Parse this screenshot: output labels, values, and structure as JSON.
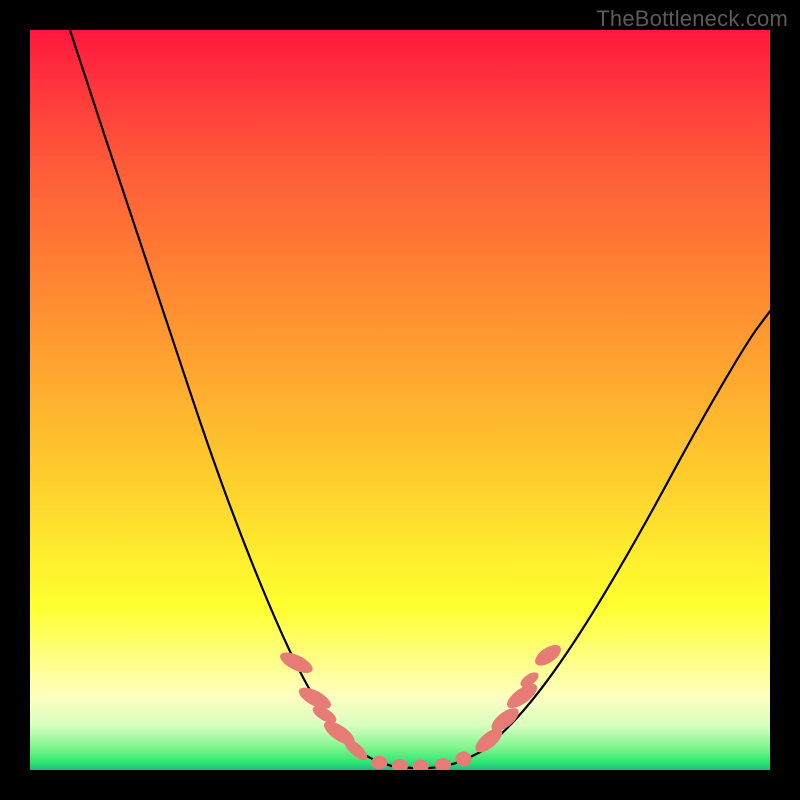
{
  "watermark": "TheBottleneck.com",
  "colors": {
    "background": "#000000",
    "curve": "#000000",
    "marker": "#e77b75",
    "gradient_top": "#ff173e",
    "gradient_bottom": "#1fb981"
  },
  "chart_data": {
    "type": "line",
    "title": "",
    "xlabel": "",
    "ylabel": "",
    "x_range": [
      0,
      1
    ],
    "y_range": [
      0,
      1
    ],
    "series": [
      {
        "name": "left-branch",
        "x": [
          0.054,
          0.08,
          0.12,
          0.16,
          0.2,
          0.24,
          0.28,
          0.32,
          0.36,
          0.4,
          0.43,
          0.46,
          0.49
        ],
        "y": [
          1.0,
          0.92,
          0.8,
          0.68,
          0.56,
          0.44,
          0.33,
          0.23,
          0.14,
          0.07,
          0.035,
          0.015,
          0.005
        ]
      },
      {
        "name": "valley",
        "x": [
          0.49,
          0.52,
          0.55,
          0.58,
          0.61
        ],
        "y": [
          0.005,
          0.002,
          0.003,
          0.01,
          0.025
        ]
      },
      {
        "name": "right-branch",
        "x": [
          0.61,
          0.65,
          0.7,
          0.76,
          0.83,
          0.9,
          0.97,
          1.0
        ],
        "y": [
          0.025,
          0.06,
          0.12,
          0.21,
          0.33,
          0.46,
          0.58,
          0.62
        ]
      }
    ],
    "markers": [
      {
        "group": "left-lobes",
        "x": 0.36,
        "y": 0.145,
        "rx": 0.01,
        "ry": 0.024,
        "rot": -64
      },
      {
        "group": "left-lobes",
        "x": 0.385,
        "y": 0.097,
        "rx": 0.01,
        "ry": 0.024,
        "rot": -62
      },
      {
        "group": "left-lobes",
        "x": 0.398,
        "y": 0.075,
        "rx": 0.008,
        "ry": 0.018,
        "rot": -60
      },
      {
        "group": "left-lobes",
        "x": 0.418,
        "y": 0.05,
        "rx": 0.01,
        "ry": 0.024,
        "rot": -56
      },
      {
        "group": "left-lobes",
        "x": 0.44,
        "y": 0.028,
        "rx": 0.008,
        "ry": 0.02,
        "rot": -48
      },
      {
        "group": "valley-lobes",
        "x": 0.472,
        "y": 0.01,
        "rx": 0.011,
        "ry": 0.009,
        "rot": 0
      },
      {
        "group": "valley-lobes",
        "x": 0.5,
        "y": 0.006,
        "rx": 0.011,
        "ry": 0.009,
        "rot": 0
      },
      {
        "group": "valley-lobes",
        "x": 0.528,
        "y": 0.005,
        "rx": 0.011,
        "ry": 0.009,
        "rot": 0
      },
      {
        "group": "valley-lobes",
        "x": 0.558,
        "y": 0.007,
        "rx": 0.011,
        "ry": 0.009,
        "rot": 0
      },
      {
        "group": "valley-lobes",
        "x": 0.586,
        "y": 0.015,
        "rx": 0.011,
        "ry": 0.01,
        "rot": 10
      },
      {
        "group": "right-lobes",
        "x": 0.62,
        "y": 0.04,
        "rx": 0.01,
        "ry": 0.022,
        "rot": 50
      },
      {
        "group": "right-lobes",
        "x": 0.642,
        "y": 0.068,
        "rx": 0.01,
        "ry": 0.022,
        "rot": 52
      },
      {
        "group": "right-lobes",
        "x": 0.665,
        "y": 0.1,
        "rx": 0.01,
        "ry": 0.024,
        "rot": 54
      },
      {
        "group": "right-lobes",
        "x": 0.675,
        "y": 0.122,
        "rx": 0.007,
        "ry": 0.014,
        "rot": 55
      },
      {
        "group": "right-lobes",
        "x": 0.7,
        "y": 0.155,
        "rx": 0.01,
        "ry": 0.02,
        "rot": 56
      }
    ]
  }
}
